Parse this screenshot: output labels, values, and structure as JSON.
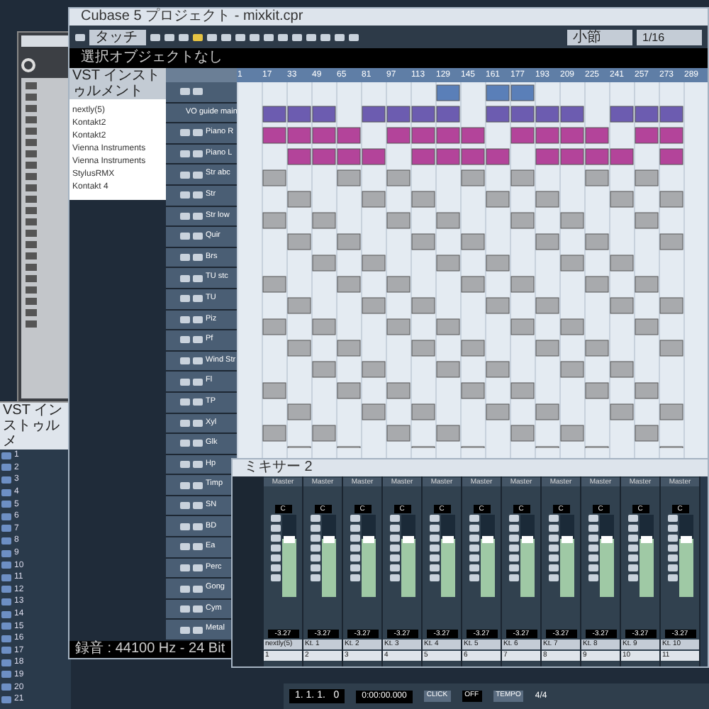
{
  "main_window": {
    "title": "Cubase 5 プロジェクト - mixkit.cpr"
  },
  "toolbar": {
    "automation_mode": "タッチ",
    "grid": "小節",
    "quantize": "1/16"
  },
  "info_line": "選択オブジェクトなし",
  "inspector": {
    "title": "VST インストゥルメント",
    "items": [
      "nextly(5)",
      "Kontakt2",
      "Kontakt2",
      "Vienna Instruments",
      "Vienna Instruments",
      "StylusRMX",
      "Kontakt 4"
    ]
  },
  "ruler": [
    "1",
    "17",
    "33",
    "49",
    "65",
    "81",
    "97",
    "113",
    "129",
    "145",
    "161",
    "177",
    "193",
    "209",
    "225",
    "241",
    "257",
    "273",
    "289"
  ],
  "tracks": [
    {
      "name": "VO guide main"
    },
    {
      "name": "Piano R"
    },
    {
      "name": "Piano L"
    },
    {
      "name": "Str abc"
    },
    {
      "name": "Str"
    },
    {
      "name": "Str low"
    },
    {
      "name": "Quir"
    },
    {
      "name": "Brs"
    },
    {
      "name": "TU stc"
    },
    {
      "name": "TU"
    },
    {
      "name": "Piz"
    },
    {
      "name": "Pf"
    },
    {
      "name": "Wind Str"
    },
    {
      "name": "Fl"
    },
    {
      "name": "TP"
    },
    {
      "name": "Xyl"
    },
    {
      "name": "Glk"
    },
    {
      "name": "Hp"
    },
    {
      "name": "Timp"
    },
    {
      "name": "SN"
    },
    {
      "name": "BD"
    },
    {
      "name": "Ea"
    },
    {
      "name": "Perc"
    },
    {
      "name": "Gong"
    },
    {
      "name": "Cym"
    },
    {
      "name": "Metal"
    }
  ],
  "status": "録音 : 44100 Hz - 24 Bit",
  "vst_window": {
    "title": "VST インストゥルメ",
    "rows": [
      "1",
      "2",
      "3",
      "4",
      "5",
      "6",
      "7",
      "8",
      "9",
      "10",
      "11",
      "12",
      "13",
      "14",
      "15",
      "16",
      "17",
      "18",
      "19",
      "20",
      "21"
    ]
  },
  "mixer": {
    "title": "ミキサー 2",
    "channels": [
      {
        "output": "Master",
        "pan": "C",
        "value": "-3.27",
        "name": "nextly(5)",
        "number": "1",
        "level": 0.7
      },
      {
        "output": "Master",
        "pan": "C",
        "value": "-3.27",
        "name": "Kt. 1",
        "number": "2",
        "level": 0.7
      },
      {
        "output": "Master",
        "pan": "C",
        "value": "-3.27",
        "name": "Kt. 2",
        "number": "3",
        "level": 0.7
      },
      {
        "output": "Master",
        "pan": "C",
        "value": "-3.27",
        "name": "Kt. 3",
        "number": "4",
        "level": 0.7
      },
      {
        "output": "Master",
        "pan": "C",
        "value": "-3.27",
        "name": "Kt. 4",
        "number": "5",
        "level": 0.7
      },
      {
        "output": "Master",
        "pan": "C",
        "value": "-3.27",
        "name": "Kt. 5",
        "number": "6",
        "level": 0.7
      },
      {
        "output": "Master",
        "pan": "C",
        "value": "-3.27",
        "name": "Kt. 6",
        "number": "7",
        "level": 0.7
      },
      {
        "output": "Master",
        "pan": "C",
        "value": "-3.27",
        "name": "Kt. 7",
        "number": "8",
        "level": 0.7
      },
      {
        "output": "Master",
        "pan": "C",
        "value": "-3.27",
        "name": "Kt. 8",
        "number": "9",
        "level": 0.7
      },
      {
        "output": "Master",
        "pan": "C",
        "value": "-3.27",
        "name": "Kt. 9",
        "number": "10",
        "level": 0.7
      },
      {
        "output": "Master",
        "pan": "C",
        "value": "-3.27",
        "name": "Kt. 10",
        "number": "11",
        "level": 0.7
      }
    ]
  },
  "transport": {
    "position": "1. 1. 1.   0",
    "time": "0:00:00.000",
    "click": "CLICK",
    "click_state": "OFF",
    "tempo": "TEMPO",
    "signature": "4/4"
  }
}
